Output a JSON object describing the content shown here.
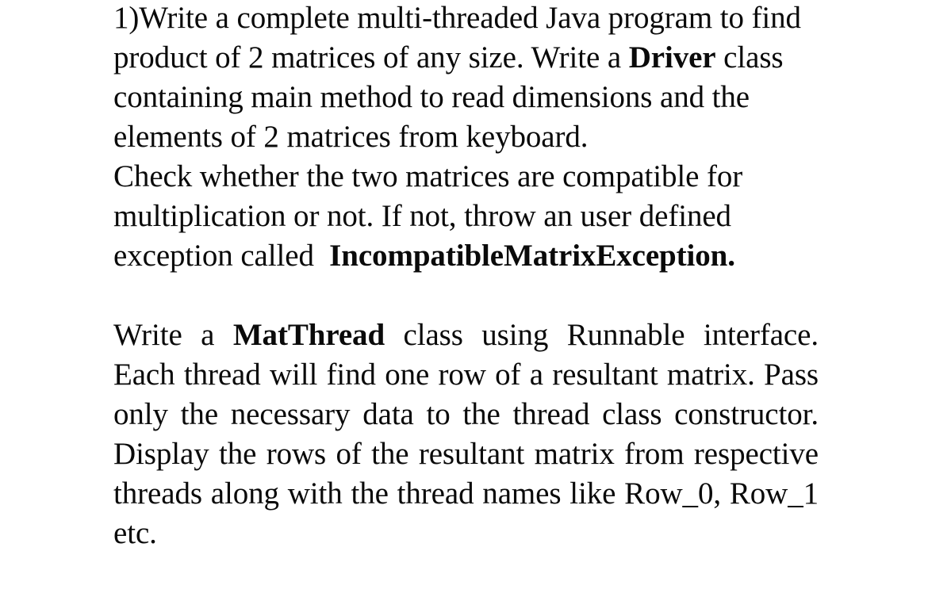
{
  "document": {
    "background_color": "#ffffff",
    "text_color": "#000000",
    "paragraphs": [
      {
        "id": "question-1",
        "alignment": "left",
        "runs": [
          {
            "text": "1)Write a complete multi-threaded Java program to find product of 2 matrices of any size. Write a ",
            "bold": false
          },
          {
            "text": "Driver",
            "bold": true
          },
          {
            "text": " class containing main method to read dimensions and the elements of 2 matrices from keyboard.",
            "bold": false
          }
        ],
        "plain_text": "1)Write a complete multi-threaded Java program to find product of 2 matrices of any size. Write a Driver class containing main method to read dimensions and the elements of 2 matrices from keyboard.",
        "lines": [
          "1)Write a complete multi-threaded Java program to",
          "find product of 2 matrices of any size. Write a",
          "Driver class containing main method to read",
          "dimensions and the elements of 2 matrices from",
          "keyboard."
        ]
      },
      {
        "id": "question-1-continued",
        "alignment": "left",
        "runs": [
          {
            "text": "Check whether the two matrices are compatible for multiplication or not. If not, throw an user defined exception called  ",
            "bold": false
          },
          {
            "text": "IncompatibleMatrixException.",
            "bold": true
          }
        ],
        "plain_text": "Check whether the two matrices are compatible for multiplication or not. If not, throw an user defined exception called  IncompatibleMatrixException.",
        "lines": [
          "Check whether the two matrices are compatible for",
          "multiplication or not. If not, throw an user defined",
          "exception called  IncompatibleMatrixException."
        ]
      },
      {
        "id": "question-2",
        "alignment": "justify",
        "runs": [
          {
            "text": "Write a ",
            "bold": false
          },
          {
            "text": "MatThread",
            "bold": true
          },
          {
            "text": " class using Runnable interface. Each thread will find one row of a resultant matrix. Pass only the necessary data to the thread class constructor. Display the rows of the resultant matrix from respective threads along with the thread names like Row_0, Row_1 etc.",
            "bold": false
          }
        ],
        "plain_text": "Write a MatThread class using Runnable interface. Each thread will find one row of a resultant matrix. Pass only the necessary data to the thread class constructor. Display the rows of the resultant matrix from respective threads along with the thread names like Row_0, Row_1 etc.",
        "lines": [
          "Write a MatThread class using Runnable interface.",
          "Each thread will find one row of a resultant matrix.",
          "Pass only the necessary data to the thread class",
          "constructor. Display the rows of the resultant matrix",
          "from respective threads along with the thread names",
          "like Row_0, Row_1 etc."
        ]
      }
    ],
    "emphasized_terms": [
      "Driver",
      "IncompatibleMatrixException.",
      "MatThread"
    ],
    "thread_name_examples": [
      "Row_0",
      "Row_1"
    ]
  },
  "p1_a": "1)Write a complete multi-threaded Java program to find product of 2 matrices of any size. Write a ",
  "p1_bold": "Driver",
  "p1_b": " class containing main method to read dimensions and the elements of 2 matrices from keyboard.",
  "p1c_a": "Check whether the two matrices are compatible for multiplication or not. If not, throw an user defined exception called ",
  "p1c_bold": "IncompatibleMatrixException.",
  "p2_a": "Write a ",
  "p2_bold": "MatThread",
  "p2_b": " class using Runnable interface. Each thread will find one row of a resultant matrix. Pass only the necessary data to the thread class constructor. Display the rows of the resultant matrix from respective threads along with the thread names ",
  "p2_last": "like Row_0, Row_1 etc."
}
